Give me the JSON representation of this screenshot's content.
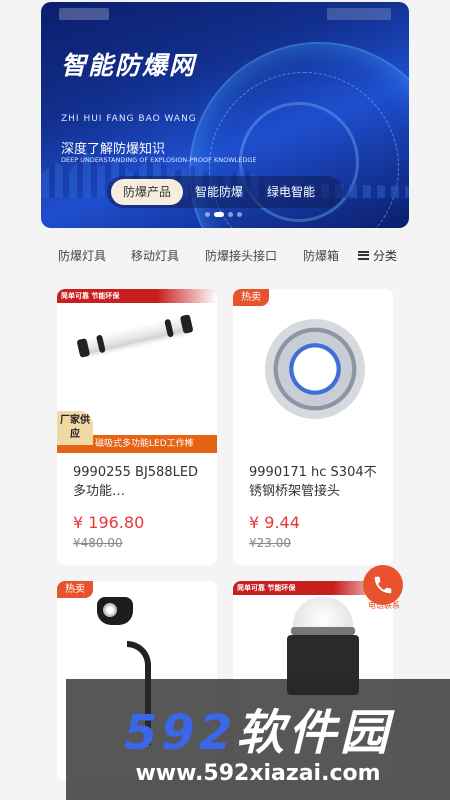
{
  "banner": {
    "title": "智能防爆网",
    "pinyin": "ZHI HUI FANG BAO WANG",
    "subtitle": "深度了解防爆知识",
    "subtitle_en": "DEEP UNDERSTANDING OF EXPLOSION-PROOF KNOWLEDGE",
    "pills": [
      "防爆产品",
      "智能防爆",
      "绿电智能"
    ],
    "active_pill": 0,
    "accent": "#1f4fd0"
  },
  "categories": {
    "tabs": [
      "防爆灯具",
      "移动灯具",
      "防爆接头接口",
      "防爆箱"
    ],
    "more_label": "分类"
  },
  "products": [
    {
      "strip": "简单可靠 节能环保",
      "factory_tag": "厂家供应",
      "bottom_tag": "磁吸式多功能LED工作棒",
      "name": "9990255 BJ588LED多功能…",
      "price": "¥ 196.80",
      "old_price": "¥480.00"
    },
    {
      "hot_tag": "热卖",
      "name": "9990171 hc S304不锈钢桥架管接头",
      "price": "¥ 9.44",
      "old_price": "¥23.00"
    },
    {
      "hot_tag": "热卖"
    },
    {
      "strip": "简单可靠 节能环保"
    }
  ],
  "contact": {
    "label": "电话联系",
    "color": "#e8532e"
  },
  "watermark": {
    "title_num": "592",
    "title_cn": "软件园",
    "url": "www.592xiazai.com"
  }
}
